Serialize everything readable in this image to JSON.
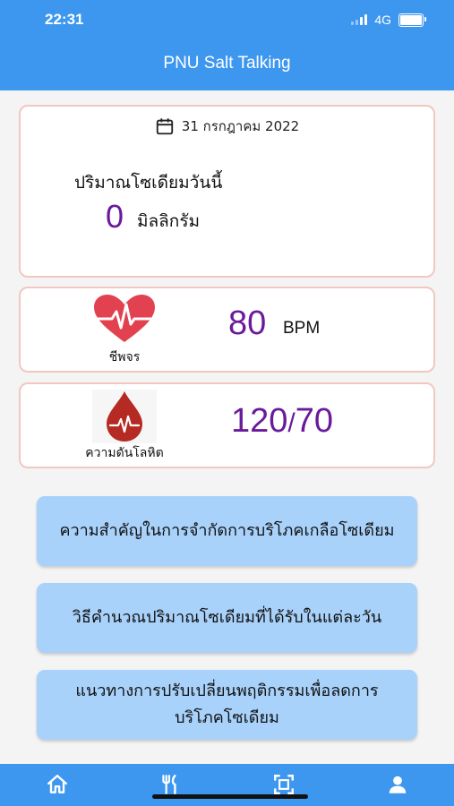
{
  "status_bar": {
    "time": "22:31",
    "network": "4G"
  },
  "header": {
    "title": "PNU Salt Talking"
  },
  "summary": {
    "date": "31 กรกฎาคม 2022",
    "sodium_label": "ปริมาณโซเดียมวันนี้",
    "sodium_value": "0",
    "sodium_unit": "มิลลิกรัม"
  },
  "heart_rate": {
    "label": "ชีพจร",
    "value": "80",
    "unit": "BPM",
    "icon": "heart-pulse-icon"
  },
  "blood_pressure": {
    "label": "ความดันโลหิต",
    "systolic": "120",
    "separator": "/",
    "diastolic": "70",
    "icon": "blood-drop-pulse-icon"
  },
  "info_buttons": [
    {
      "label": "ความสำคัญในการจำกัดการบริโภคเกลือโซเดียม"
    },
    {
      "label": "วิธีคำนวณปริมาณโซเดียมที่ได้รับในแต่ละวัน"
    },
    {
      "label": "แนวทางการปรับเปลี่ยนพฤติกรรมเพื่อลดการบริโภคโซเดียม"
    }
  ],
  "tabs": [
    {
      "icon": "home-icon"
    },
    {
      "icon": "fork-knife-icon"
    },
    {
      "icon": "scan-icon"
    },
    {
      "icon": "person-icon"
    }
  ],
  "colors": {
    "primary": "#3d97ef",
    "value": "#6a1a9a",
    "card_border": "#f0c8c0",
    "button": "#a9d2fb"
  }
}
